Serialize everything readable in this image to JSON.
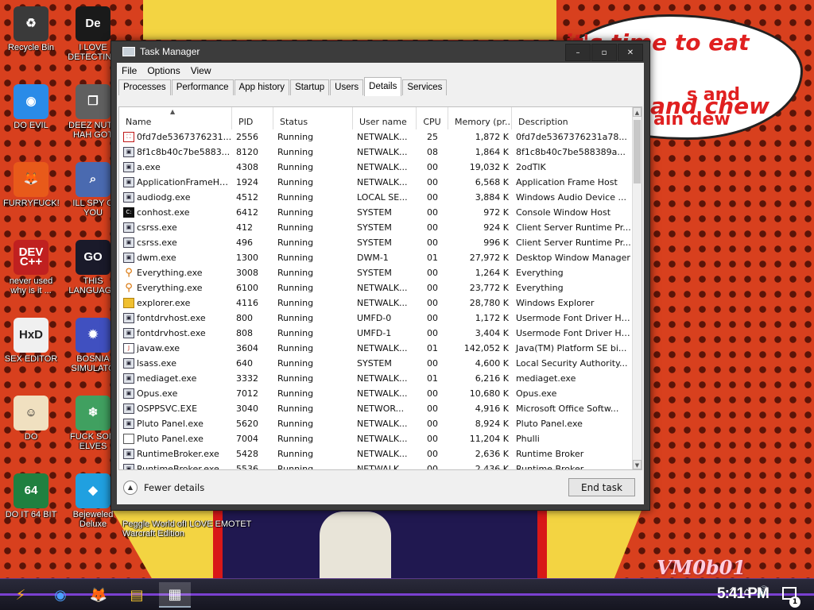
{
  "desktop": {
    "icons": [
      {
        "label": "Recycle Bin",
        "glyph": "♻",
        "color": "#3a3a3a"
      },
      {
        "label": "I LOVE DETECTING",
        "glyph": "De",
        "color": "#1a1a1a"
      },
      {
        "label": "DO EVIL",
        "glyph": "◉",
        "color": "#2a8be8"
      },
      {
        "label": "DEEZ NUTZ HAH GOT",
        "glyph": "❐",
        "color": "#606060"
      },
      {
        "label": "FURRYFUCK!",
        "glyph": "🦊",
        "color": "#e85a1a"
      },
      {
        "label": "ILL SPY O YOU",
        "glyph": "⌕",
        "color": "#4a6ab0"
      },
      {
        "label": "never used why is it ...",
        "glyph": "DEV C++",
        "color": "#c02020"
      },
      {
        "label": "THIS LANGUAGE",
        "glyph": "GO",
        "color": "#1a1a2a"
      },
      {
        "label": "SEX EDITOR",
        "glyph": "HxD",
        "color": "#f0f0f0"
      },
      {
        "label": "BOSNIA SIMULATO",
        "glyph": "✹",
        "color": "#4050c0"
      },
      {
        "label": "DO",
        "glyph": "☺",
        "color": "#f0e0c0"
      },
      {
        "label": "FUCK SOM ELVES",
        "glyph": "❄",
        "color": "#40a060"
      },
      {
        "label": "DO IT 64 BIT",
        "glyph": "64",
        "color": "#208040"
      },
      {
        "label": "Bejeweled Deluxe",
        "glyph": "◆",
        "color": "#20a0e0"
      }
    ],
    "extra_labels": [
      "Peggle World of Warcraft Edition",
      "I LOVE EMOTET"
    ],
    "speech_bubble": {
      "line1": "it's time to eat shit",
      "line2": "and chew",
      "line3": "s and",
      "line4": "ain dew"
    },
    "watermark": "VM0b01"
  },
  "task_manager": {
    "title": "Task Manager",
    "window_buttons": {
      "minimize": "–",
      "maximize": "▫",
      "close": "✕"
    },
    "menu": [
      "File",
      "Options",
      "View"
    ],
    "tabs": [
      "Processes",
      "Performance",
      "App history",
      "Startup",
      "Users",
      "Details",
      "Services"
    ],
    "active_tab": "Details",
    "columns": [
      "Name",
      "PID",
      "Status",
      "User name",
      "CPU",
      "Memory (pr...",
      "Description"
    ],
    "rows": [
      {
        "icon": "pdf",
        "name": "0fd7de5367376231...",
        "pid": "2556",
        "status": "Running",
        "user": "NETWALK...",
        "cpu": "25",
        "memory": "1,872 K",
        "description": "0fd7de5367376231a78..."
      },
      {
        "icon": "exe",
        "name": "8f1c8b40c7be5883...",
        "pid": "8120",
        "status": "Running",
        "user": "NETWALK...",
        "cpu": "08",
        "memory": "1,864 K",
        "description": "8f1c8b40c7be588389a..."
      },
      {
        "icon": "exe",
        "name": "a.exe",
        "pid": "4308",
        "status": "Running",
        "user": "NETWALK...",
        "cpu": "00",
        "memory": "19,032 K",
        "description": "2odTlK"
      },
      {
        "icon": "exe",
        "name": "ApplicationFrameHos...",
        "pid": "1924",
        "status": "Running",
        "user": "NETWALK...",
        "cpu": "00",
        "memory": "6,568 K",
        "description": "Application Frame Host"
      },
      {
        "icon": "exe",
        "name": "audiodg.exe",
        "pid": "4512",
        "status": "Running",
        "user": "LOCAL SE...",
        "cpu": "00",
        "memory": "3,884 K",
        "description": "Windows Audio Device ..."
      },
      {
        "icon": "console",
        "name": "conhost.exe",
        "pid": "6412",
        "status": "Running",
        "user": "SYSTEM",
        "cpu": "00",
        "memory": "972 K",
        "description": "Console Window Host"
      },
      {
        "icon": "exe",
        "name": "csrss.exe",
        "pid": "412",
        "status": "Running",
        "user": "SYSTEM",
        "cpu": "00",
        "memory": "924 K",
        "description": "Client Server Runtime Pr..."
      },
      {
        "icon": "exe",
        "name": "csrss.exe",
        "pid": "496",
        "status": "Running",
        "user": "SYSTEM",
        "cpu": "00",
        "memory": "996 K",
        "description": "Client Server Runtime Pr..."
      },
      {
        "icon": "exe",
        "name": "dwm.exe",
        "pid": "1300",
        "status": "Running",
        "user": "DWM-1",
        "cpu": "01",
        "memory": "27,972 K",
        "description": "Desktop Window Manager"
      },
      {
        "icon": "search",
        "name": "Everything.exe",
        "pid": "3008",
        "status": "Running",
        "user": "SYSTEM",
        "cpu": "00",
        "memory": "1,264 K",
        "description": "Everything"
      },
      {
        "icon": "search",
        "name": "Everything.exe",
        "pid": "6100",
        "status": "Running",
        "user": "NETWALK...",
        "cpu": "00",
        "memory": "23,772 K",
        "description": "Everything"
      },
      {
        "icon": "folder",
        "name": "explorer.exe",
        "pid": "4116",
        "status": "Running",
        "user": "NETWALK...",
        "cpu": "00",
        "memory": "28,780 K",
        "description": "Windows Explorer"
      },
      {
        "icon": "exe",
        "name": "fontdrvhost.exe",
        "pid": "800",
        "status": "Running",
        "user": "UMFD-0",
        "cpu": "00",
        "memory": "1,172 K",
        "description": "Usermode Font Driver Host"
      },
      {
        "icon": "exe",
        "name": "fontdrvhost.exe",
        "pid": "808",
        "status": "Running",
        "user": "UMFD-1",
        "cpu": "00",
        "memory": "3,404 K",
        "description": "Usermode Font Driver Host"
      },
      {
        "icon": "java",
        "name": "javaw.exe",
        "pid": "3604",
        "status": "Running",
        "user": "NETWALK...",
        "cpu": "01",
        "memory": "142,052 K",
        "description": "Java(TM) Platform SE bi..."
      },
      {
        "icon": "exe",
        "name": "lsass.exe",
        "pid": "640",
        "status": "Running",
        "user": "SYSTEM",
        "cpu": "00",
        "memory": "4,600 K",
        "description": "Local Security Authority..."
      },
      {
        "icon": "exe",
        "name": "mediaget.exe",
        "pid": "3332",
        "status": "Running",
        "user": "NETWALK...",
        "cpu": "01",
        "memory": "6,216 K",
        "description": "mediaget.exe"
      },
      {
        "icon": "exe",
        "name": "Opus.exe",
        "pid": "7012",
        "status": "Running",
        "user": "NETWALK...",
        "cpu": "00",
        "memory": "10,680 K",
        "description": "Opus.exe"
      },
      {
        "icon": "exe",
        "name": "OSPPSVC.EXE",
        "pid": "3040",
        "status": "Running",
        "user": "NETWOR...",
        "cpu": "00",
        "memory": "4,916 K",
        "description": "Microsoft Office Softw..."
      },
      {
        "icon": "exe",
        "name": "Pluto Panel.exe",
        "pid": "5620",
        "status": "Running",
        "user": "NETWALK...",
        "cpu": "00",
        "memory": "8,924 K",
        "description": "Pluto Panel.exe"
      },
      {
        "icon": "blank",
        "name": "Pluto Panel.exe",
        "pid": "7004",
        "status": "Running",
        "user": "NETWALK...",
        "cpu": "00",
        "memory": "11,204 K",
        "description": "Phulli"
      },
      {
        "icon": "exe",
        "name": "RuntimeBroker.exe",
        "pid": "5428",
        "status": "Running",
        "user": "NETWALK...",
        "cpu": "00",
        "memory": "2,636 K",
        "description": "Runtime Broker"
      },
      {
        "icon": "exe",
        "name": "RuntimeBroker.exe",
        "pid": "5536",
        "status": "Running",
        "user": "NETWALK...",
        "cpu": "00",
        "memory": "2,436 K",
        "description": "Runtime Broker"
      }
    ],
    "footer": {
      "fewer_details": "Fewer details",
      "end_task": "End task"
    }
  },
  "taskbar": {
    "items": [
      {
        "name": "start",
        "glyph": "⚡"
      },
      {
        "name": "chrome",
        "glyph": "◉"
      },
      {
        "name": "firefox",
        "glyph": "🦊"
      },
      {
        "name": "file-explorer",
        "glyph": "▤"
      },
      {
        "name": "task-manager",
        "glyph": "▦"
      }
    ],
    "tray_icons": [
      "^",
      "⌂",
      "🔊"
    ],
    "clock": "5:41 PM",
    "notifications": "1"
  }
}
